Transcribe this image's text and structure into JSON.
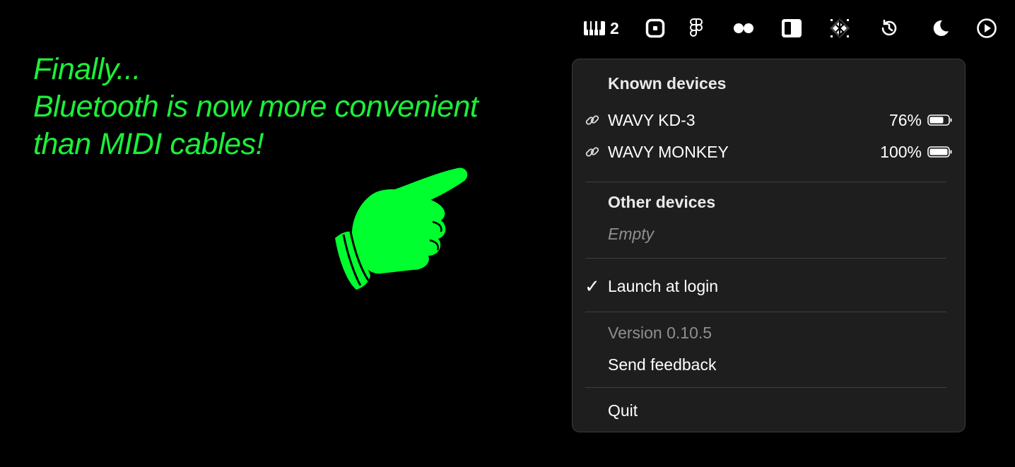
{
  "menubar": {
    "piano_count": "2",
    "icons": [
      "piano-keys-icon",
      "stop-square-icon",
      "figma-icon",
      "two-dots-icon",
      "sidebar-panel-icon",
      "bluetooth-pattern-icon",
      "history-clock-icon",
      "moon-icon",
      "play-circle-icon"
    ]
  },
  "promo": {
    "line1": "Finally...",
    "line2": "Bluetooth is now more convenient",
    "line3": "than MIDI cables!"
  },
  "menu": {
    "known_header": "Known devices",
    "devices": [
      {
        "name": "WAVY KD-3",
        "battery": "76%",
        "level": 0.76
      },
      {
        "name": "WAVY MONKEY",
        "battery": "100%",
        "level": 1.0
      }
    ],
    "other_header": "Other devices",
    "other_empty": "Empty",
    "launch_check": "✓",
    "launch_label": "Launch at login",
    "version": "Version 0.10.5",
    "feedback": "Send feedback",
    "quit": "Quit"
  },
  "colors": {
    "accent_green": "#1bf03a",
    "menu_bg": "#1e1e1e"
  }
}
